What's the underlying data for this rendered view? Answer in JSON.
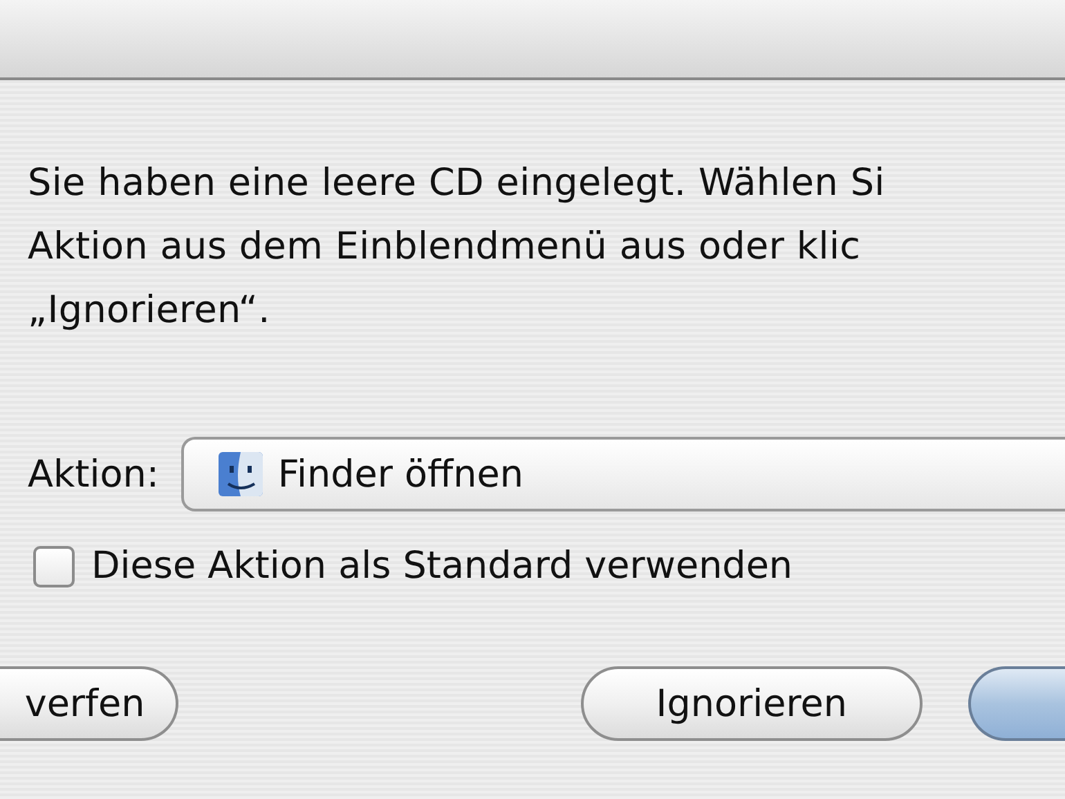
{
  "message": {
    "lines": [
      "Sie haben eine leere CD eingelegt. Wählen Si",
      "Aktion aus dem Einblendmenü aus oder klic",
      "„Ignorieren“."
    ]
  },
  "action": {
    "label": "Aktion:",
    "value": "Finder öffnen"
  },
  "checkbox": {
    "label": "Diese Aktion als Standard verwenden",
    "checked": false
  },
  "buttons": [
    {
      "kind": "left-edge",
      "label": "verfen"
    },
    {
      "kind": "normal",
      "label": "Ignorieren"
    },
    {
      "kind": "default-edge"
    }
  ]
}
